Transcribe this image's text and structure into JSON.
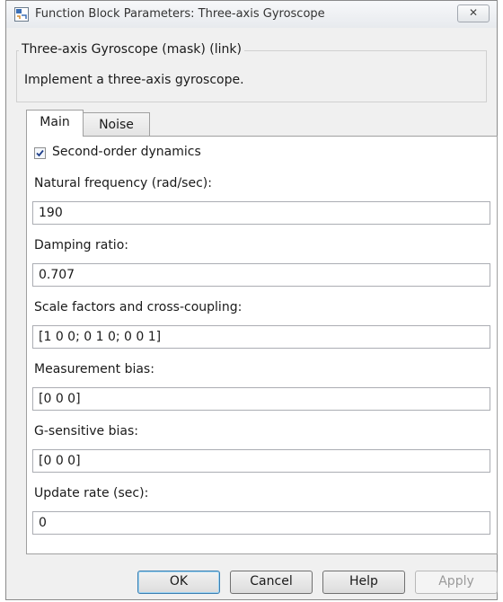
{
  "window": {
    "title": "Function Block Parameters: Three-axis Gyroscope",
    "close_glyph": "✕"
  },
  "block": {
    "name": "Three-axis Gyroscope (mask) (link)",
    "description": "Implement a three-axis gyroscope."
  },
  "tabs": [
    {
      "label": "Main",
      "selected": true
    },
    {
      "label": "Noise",
      "selected": false
    }
  ],
  "main": {
    "checkbox": {
      "label": "Second-order dynamics",
      "checked": true
    },
    "fields": [
      {
        "label": "Natural frequency (rad/sec):",
        "value": "190"
      },
      {
        "label": "Damping ratio:",
        "value": "0.707"
      },
      {
        "label": "Scale factors and cross-coupling:",
        "value": "[1 0 0; 0 1 0; 0 0 1]"
      },
      {
        "label": "Measurement bias:",
        "value": "[0 0 0]"
      },
      {
        "label": "G-sensitive bias:",
        "value": "[0 0 0]"
      },
      {
        "label": "Update rate (sec):",
        "value": "0"
      }
    ]
  },
  "buttons": {
    "ok": "OK",
    "cancel": "Cancel",
    "help": "Help",
    "apply": "Apply"
  },
  "icons": {
    "app": "simulink-block-icon",
    "close": "close-icon",
    "check": "checkmark-icon"
  }
}
